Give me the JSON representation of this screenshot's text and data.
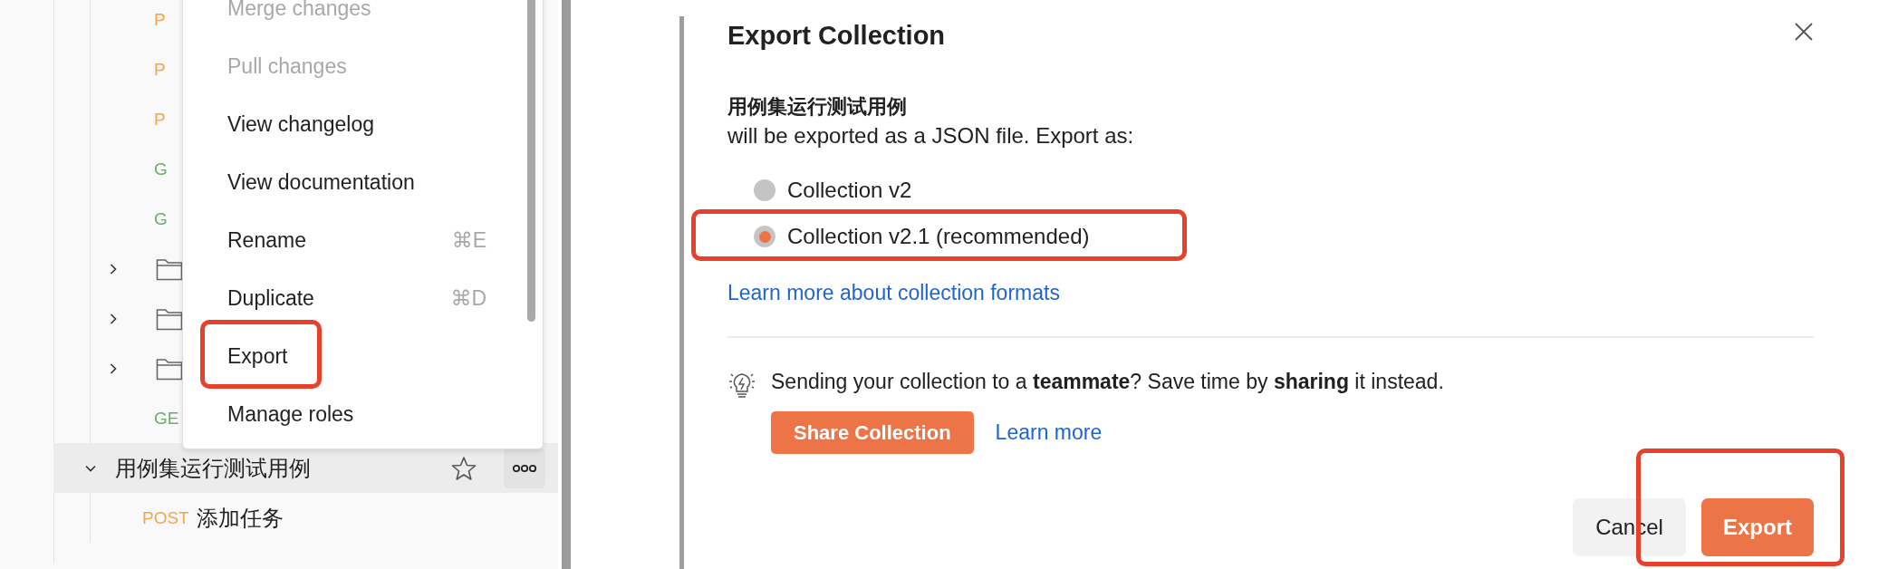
{
  "sidebar": {
    "items": [
      {
        "kind": "request",
        "method": "P",
        "color": "#f2a54c"
      },
      {
        "kind": "request",
        "method": "P",
        "color": "#f2a54c"
      },
      {
        "kind": "request",
        "method": "P",
        "color": "#f2a54c"
      },
      {
        "kind": "request",
        "method": "G",
        "color": "#6aad6a"
      },
      {
        "kind": "request",
        "method": "G",
        "color": "#6aad6a"
      },
      {
        "kind": "folder",
        "expanded": false
      },
      {
        "kind": "folder",
        "expanded": false
      },
      {
        "kind": "folder",
        "expanded": false
      },
      {
        "kind": "request",
        "method": "GE",
        "color": "#6aad6a"
      }
    ],
    "collection": {
      "name": "用例集运行测试用例",
      "expanded": true,
      "selected": true,
      "starred": false,
      "children": [
        {
          "method": "POST",
          "color": "#f2a54c",
          "name": "添加任务"
        }
      ]
    }
  },
  "context_menu": {
    "items": [
      {
        "label": "Merge changes",
        "disabled": true,
        "highlighted": false
      },
      {
        "label": "Pull changes",
        "disabled": true,
        "highlighted": false
      },
      {
        "label": "View changelog",
        "disabled": false,
        "highlighted": false
      },
      {
        "label": "View documentation",
        "disabled": false,
        "highlighted": false
      },
      {
        "label": "Rename",
        "shortcut": "⌘E",
        "disabled": false,
        "highlighted": false
      },
      {
        "label": "Duplicate",
        "shortcut": "⌘D",
        "disabled": false,
        "highlighted": false
      },
      {
        "label": "Export",
        "disabled": false,
        "highlighted": true
      },
      {
        "label": "Manage roles",
        "disabled": false,
        "highlighted": false
      }
    ]
  },
  "dialog": {
    "title": "Export Collection",
    "collection_name": "用例集运行测试用例",
    "description": "will be exported as a JSON file. Export as:",
    "formats": [
      {
        "label": "Collection v2",
        "selected": false,
        "highlighted": false
      },
      {
        "label": "Collection v2.1 (recommended)",
        "selected": true,
        "highlighted": true
      }
    ],
    "formats_link": "Learn more about collection formats",
    "tip": "Sending your collection to a **teammate**? Save time by **sharing** it instead.",
    "share_button": "Share Collection",
    "learn_more": "Learn more",
    "buttons": [
      {
        "label": "Cancel",
        "kind": "secondary",
        "highlighted": false
      },
      {
        "label": "Export",
        "kind": "primary",
        "highlighted": true
      }
    ]
  }
}
